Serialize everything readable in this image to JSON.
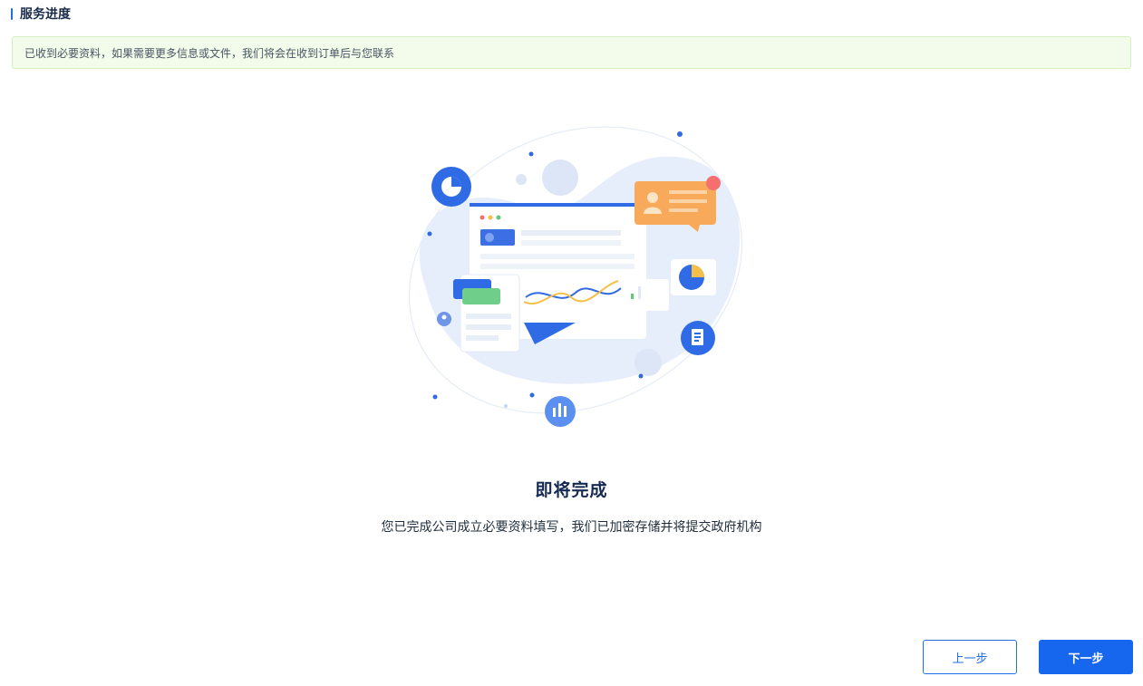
{
  "header": {
    "title": "服务进度"
  },
  "notice": {
    "text": "已收到必要资料，如果需要更多信息或文件，我们将会在收到订单后与您联系"
  },
  "status": {
    "title": "即将完成",
    "description": "您已完成公司成立必要资料填写，我们已加密存储并将提交政府机构"
  },
  "actions": {
    "prev_label": "上一步",
    "next_label": "下一步"
  },
  "colors": {
    "primary": "#1766ee",
    "notice_bg": "#f3fbea",
    "notice_border": "#d6efc0",
    "title_text": "#152a52"
  }
}
